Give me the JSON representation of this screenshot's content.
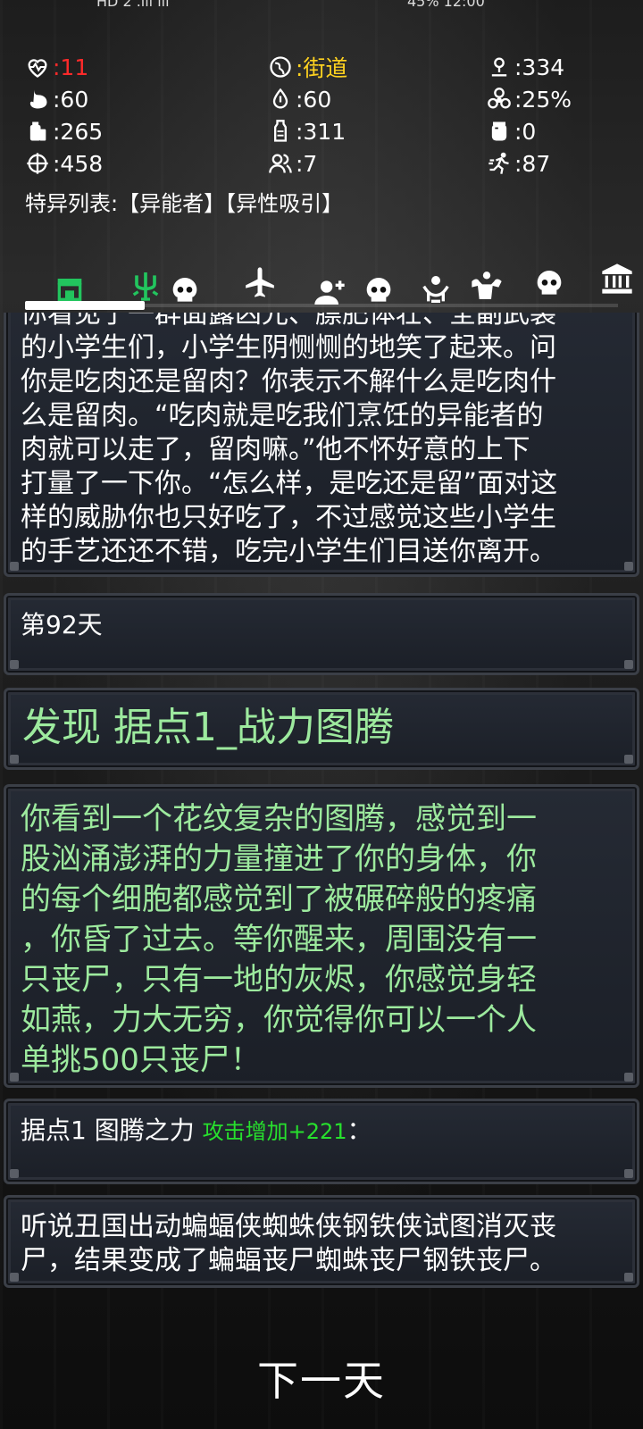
{
  "status_bar": {
    "left": "HD 2 .ill ill",
    "right": "45% 12:00"
  },
  "stats": {
    "health": ":11",
    "location": ":街道",
    "distance": ":334",
    "hunger": ":60",
    "water": ":60",
    "infection": ":25%",
    "food": ":265",
    "drink": ":311",
    "item": ":0",
    "attack": ":458",
    "survivors": ":7",
    "speed": ":87"
  },
  "special_list": "特异列表:【异能者】【异性吸引】",
  "tabs": [
    {
      "icon": "shop-icon",
      "color": "#22c55e"
    },
    {
      "icon": "trident-icon",
      "color": "#22c55e"
    },
    {
      "icon": "skull-icon",
      "color": "#ffffff"
    },
    {
      "icon": "airplane-icon",
      "color": "#ffffff"
    },
    {
      "icon": "add-person-icon",
      "color": "#ffffff"
    },
    {
      "icon": "skull-icon",
      "color": "#ffffff"
    },
    {
      "icon": "hands-icon",
      "color": "#ffffff"
    },
    {
      "icon": "muscle-icon",
      "color": "#ffffff"
    },
    {
      "icon": "skull-icon",
      "color": "#ffffff"
    },
    {
      "icon": "bank-icon",
      "color": "#ffffff"
    }
  ],
  "log": {
    "story_top": [
      "你看见了一群面露凶光、膘肥体壮、全副武装",
      "的小学生们，小学生阴恻恻的地笑了起来。问",
      "你是吃肉还是留肉？你表示不解什么是吃肉什",
      "么是留肉。“吃肉就是吃我们烹饪的异能者的",
      "肉就可以走了，留肉嘛。”他不怀好意的上下",
      "打量了一下你。“怎么样，是吃还是留”面对这",
      "样的威胁你也只好吃了，不过感觉这些小学生",
      "的手艺还还不错，吃完小学生们目送你离开。"
    ],
    "day": "第92天",
    "discovery": "发现 据点1_战力图腾",
    "totem_story": [
      "你看到一个花纹复杂的图腾，感觉到一",
      "股汹涌澎湃的力量撞进了你的身体，你",
      "的每个细胞都感觉到了被碾碎般的疼痛",
      "，你昏了过去。等你醒来，周围没有一",
      "只丧尸，只有一地的灰烬，你感觉身轻",
      "如燕，力大无穷，你觉得你可以一个人",
      "单挑500只丧尸！"
    ],
    "totem_power_label": "据点1 图腾之力 ",
    "totem_power_bonus": "攻击增加+221",
    "totem_power_colon": "：",
    "rumor": [
      "听说丑国出动蝙蝠侠蜘蛛侠钢铁侠试图消灭丧",
      "尸，结果变成了蝙蝠丧尸蜘蛛丧尸钢铁丧尸。"
    ]
  },
  "next_day_label": "下一天",
  "colors": {
    "health": "#ff2a2a",
    "location": "#ffd21f",
    "story_green": "#9dea9e",
    "bonus_green": "#27e02d"
  }
}
